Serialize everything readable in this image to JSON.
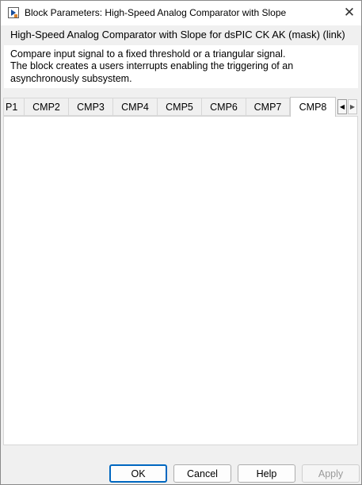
{
  "window": {
    "title": "Block Parameters: High-Speed Analog Comparator with Slope",
    "close_glyph": "✕"
  },
  "mask": {
    "title": "High-Speed Analog Comparator with Slope for dsPIC CK  AK (mask) (link)",
    "description": [
      "Compare input signal to a fixed threshold or a triangular signal.",
      "The block creates a users interrupts enabling the triggering of an",
      "asynchronously subsystem."
    ]
  },
  "tabs": {
    "items": [
      "P1",
      "CMP2",
      "CMP3",
      "CMP4",
      "CMP5",
      "CMP6",
      "CMP7",
      "CMP8"
    ],
    "active": "CMP8",
    "scroll_left": "◀",
    "scroll_right": "▶"
  },
  "buttons": {
    "ok": "OK",
    "cancel": "Cancel",
    "help": "Help",
    "apply": "Apply"
  },
  "icons": {
    "app": "block-parameters-icon",
    "close": "close-icon"
  }
}
